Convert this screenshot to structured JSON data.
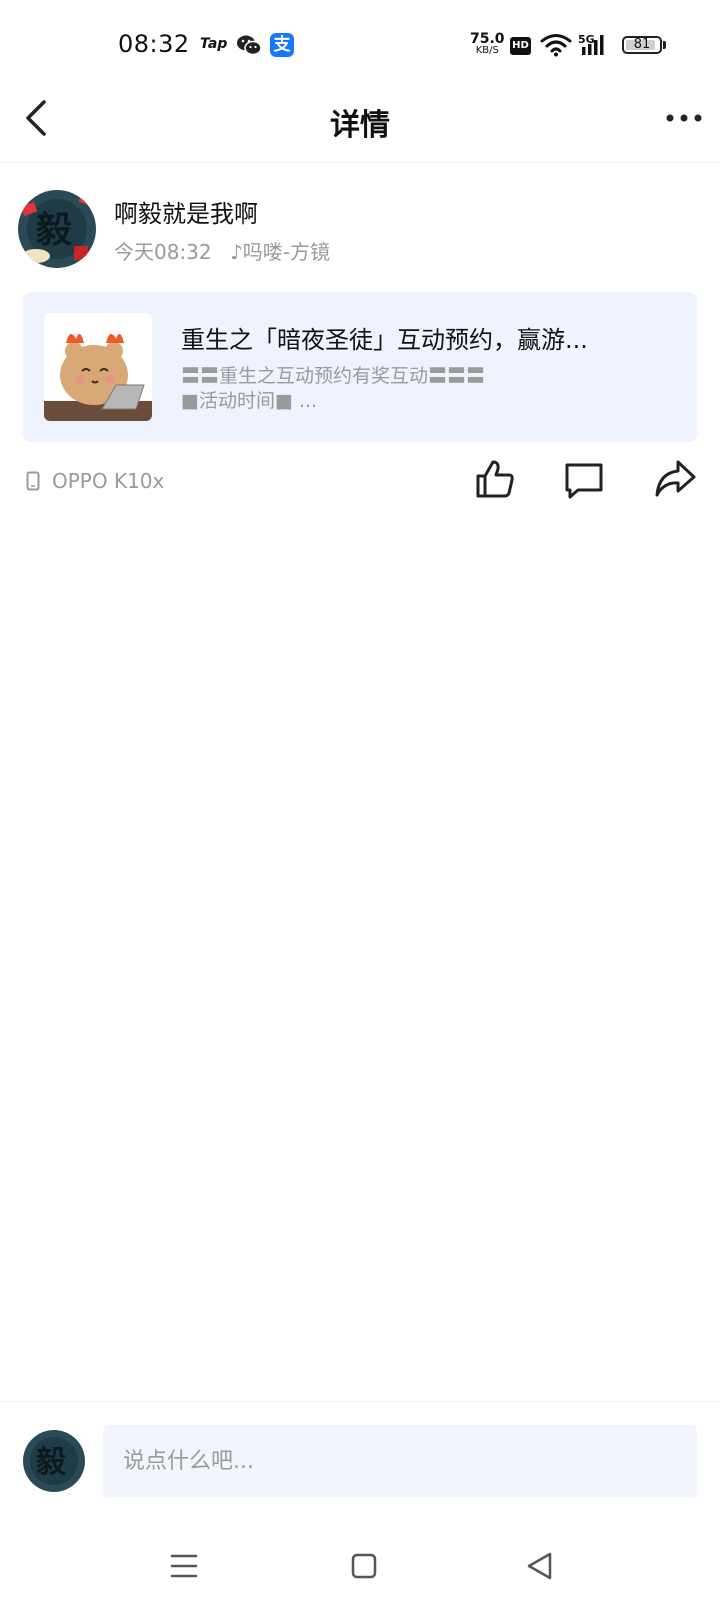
{
  "status_bar": {
    "time": "08:32",
    "app_icons": [
      "Tap",
      "wechat-icon",
      "alipay-icon"
    ],
    "tap_label": "Tap",
    "alipay_label": "支",
    "net_speed_value": "75.0",
    "net_speed_unit": "KB/S",
    "hd_label": "HD",
    "network": "5G",
    "battery": "81"
  },
  "header": {
    "title": "详情",
    "back_icon": "chevron-left-icon",
    "more_icon": "more-dots-icon"
  },
  "post": {
    "author": "啊毅就是我啊",
    "time": "今天08:32",
    "music": "吗喽-方镜",
    "card": {
      "title": "重生之「暗夜圣徒」互动预约，赢游...",
      "desc_line1": "〓〓重生之互动预约有奖互动〓〓〓",
      "desc_line2": "■活动时间■  ..."
    },
    "device": "OPPO K10x"
  },
  "comment_bar": {
    "placeholder": "说点什么吧..."
  },
  "colors": {
    "card_bg": "#eef3fd",
    "input_bg": "#f2f5fc",
    "muted_text": "#9a9a9a",
    "alipay_blue": "#1677ff"
  }
}
